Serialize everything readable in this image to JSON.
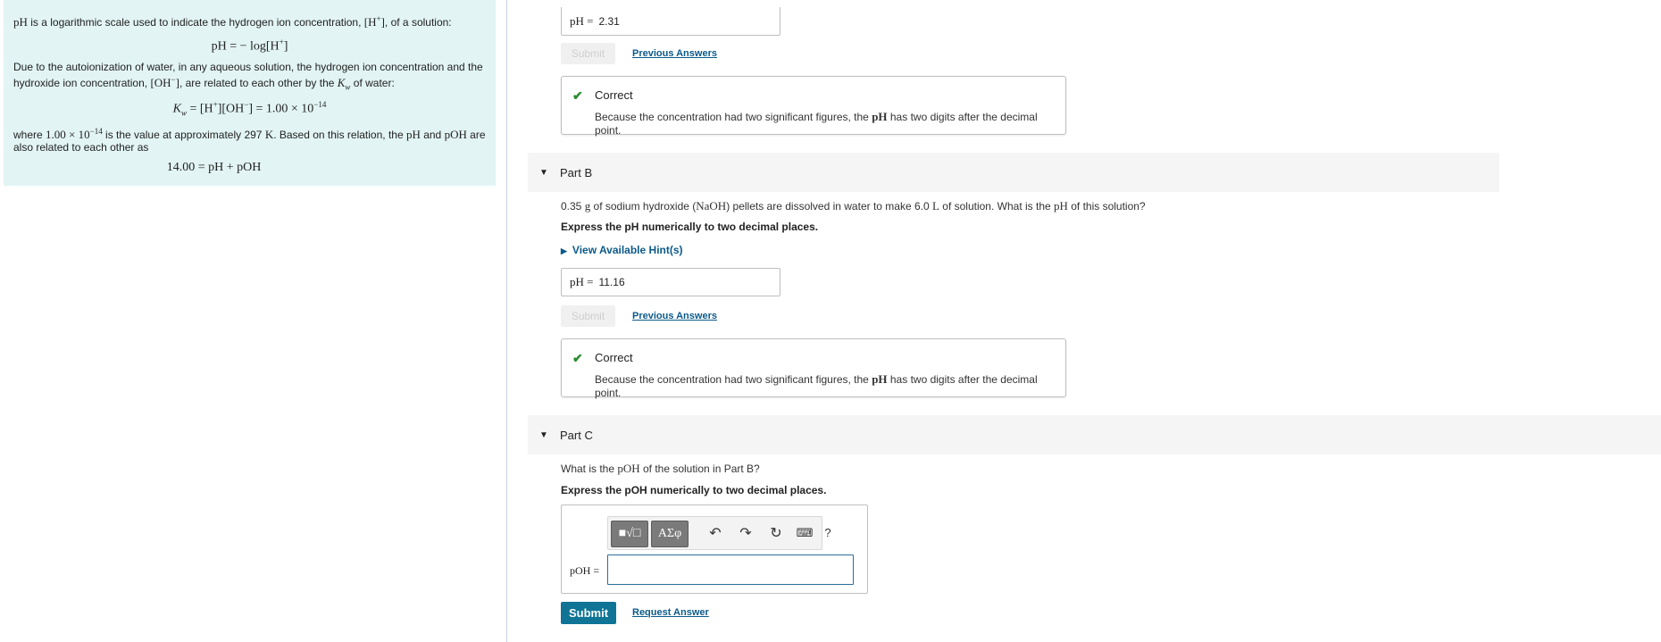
{
  "intro": {
    "p1_a": "pH",
    "p1_b": " is a logarithmic scale used to indicate the hydrogen ion concentration, ",
    "p1_c": "[H",
    "p1_c_sup": "+",
    "p1_d": "]",
    "p1_e": ", of a solution:",
    "eq1": "pH = − log[H",
    "eq1_sup": "+",
    "eq1_end": "]",
    "p2_a": "Due to the autoionization of water, in any aqueous solution, the hydrogen ion concentration and the hydroxide ion concentration, ",
    "p2_b": "[OH",
    "p2_b_sup": "−",
    "p2_c": "]",
    "p2_d": ", are related to each other by the ",
    "p2_k": "K",
    "p2_k_sub": "w",
    "p2_e": " of water:",
    "eq2_k": "K",
    "eq2_k_sub": "w",
    "eq2_a": " = [H",
    "eq2_a_sup": "+",
    "eq2_b": "][OH",
    "eq2_b_sup": "−",
    "eq2_c": "] = 1.00 × 10",
    "eq2_c_sup": "−14",
    "p3_a": "where ",
    "p3_b": "1.00 × 10",
    "p3_b_sup": "−14",
    "p3_c": " is the value at approximately 297 ",
    "p3_k": "K",
    "p3_d": ". Based on this relation, the ",
    "p3_ph": "pH",
    "p3_and": " and ",
    "p3_poh": "pOH",
    "p3_e": " are also related to each other as",
    "eq3": "14.00 = pH + pOH"
  },
  "partA": {
    "answer_label": "pH =",
    "answer_value": "2.31",
    "submit_label": "Submit",
    "prev_label": "Previous Answers",
    "feedback_title": "Correct",
    "feedback_a": "Because the concentration had two significant figures, the ",
    "feedback_ph": "pH",
    "feedback_b": " has two digits after the decimal point."
  },
  "partB": {
    "title": "Part B",
    "q_a": "0.35 ",
    "q_g": "g",
    "q_b": " of sodium hydroxide (",
    "q_naoh": "NaOH",
    "q_c": ") pellets are dissolved in water to make 6.0 ",
    "q_l": "L",
    "q_d": " of solution. What is the ",
    "q_ph": "pH",
    "q_e": " of this solution?",
    "express": "Express the pH numerically to two decimal places.",
    "hint_label": "View Available Hint(s)",
    "answer_label": "pH =",
    "answer_value": "11.16",
    "submit_label": "Submit",
    "prev_label": "Previous Answers",
    "feedback_title": "Correct",
    "feedback_a": "Because the concentration had two significant figures, the ",
    "feedback_ph": "pH",
    "feedback_b": " has two digits after the decimal point."
  },
  "partC": {
    "title": "Part C",
    "q_a": "What is the ",
    "q_poh": "pOH",
    "q_b": " of the solution in Part B?",
    "express": "Express the pOH numerically to two decimal places.",
    "tb_templates": "■√□",
    "tb_symbols": "ΑΣφ",
    "tb_help": "?",
    "answer_label": "pOH =",
    "answer_value": "",
    "submit_label": "Submit",
    "request_label": "Request Answer"
  },
  "icons": [
    "check-icon",
    "caret-down-icon",
    "caret-right-icon",
    "undo-icon",
    "redo-icon",
    "reset-icon",
    "keyboard-icon",
    "help-icon"
  ],
  "colors": {
    "info_bg": "#e2f4f4",
    "link": "#0b5a8a",
    "correct": "#2a8a2e",
    "submit_bg": "#0f7495"
  }
}
